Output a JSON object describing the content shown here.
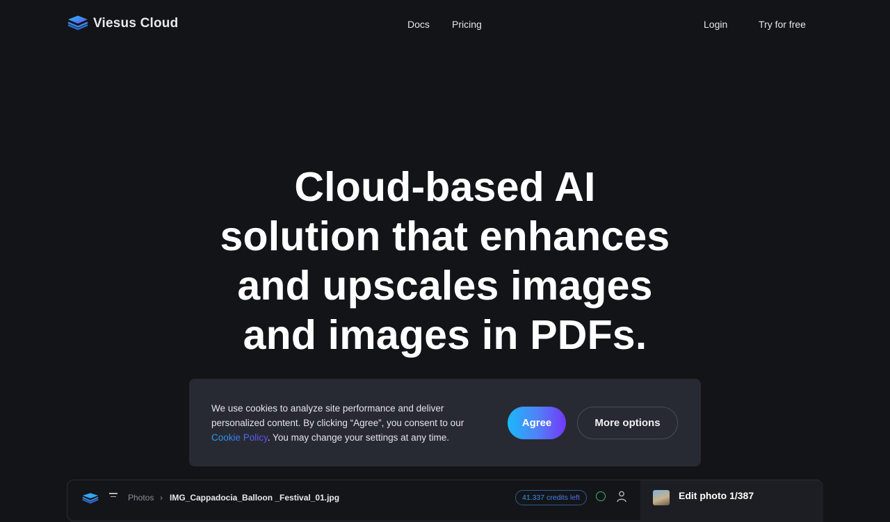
{
  "header": {
    "brand": "Viesus Cloud",
    "nav": [
      {
        "label": "Docs"
      },
      {
        "label": "Pricing"
      }
    ],
    "login_label": "Login",
    "try_label": "Try for free"
  },
  "hero": {
    "lines": [
      "Cloud-based AI",
      "solution that enhances",
      "and upscales images",
      "and images in PDFs."
    ]
  },
  "cookie_banner": {
    "text_before": "We use cookies to analyze site performance and deliver personalized content. By clicking “Agree”, you consent to our ",
    "link_label": "Cookie Policy",
    "text_after": ". You may change your settings at any time.",
    "agree_label": "Agree",
    "more_label": "More options",
    "colors": {
      "gradient_start": "#1cb7fb",
      "gradient_end": "#7338f6"
    }
  },
  "preview": {
    "breadcrumb_root": "Photos",
    "breadcrumb_sep": "›",
    "file_name": "IMG_Cappadocia_Balloon _Festival_01.jpg",
    "credits": "41.337 credits left",
    "edit_title": "Edit photo 1/387"
  }
}
